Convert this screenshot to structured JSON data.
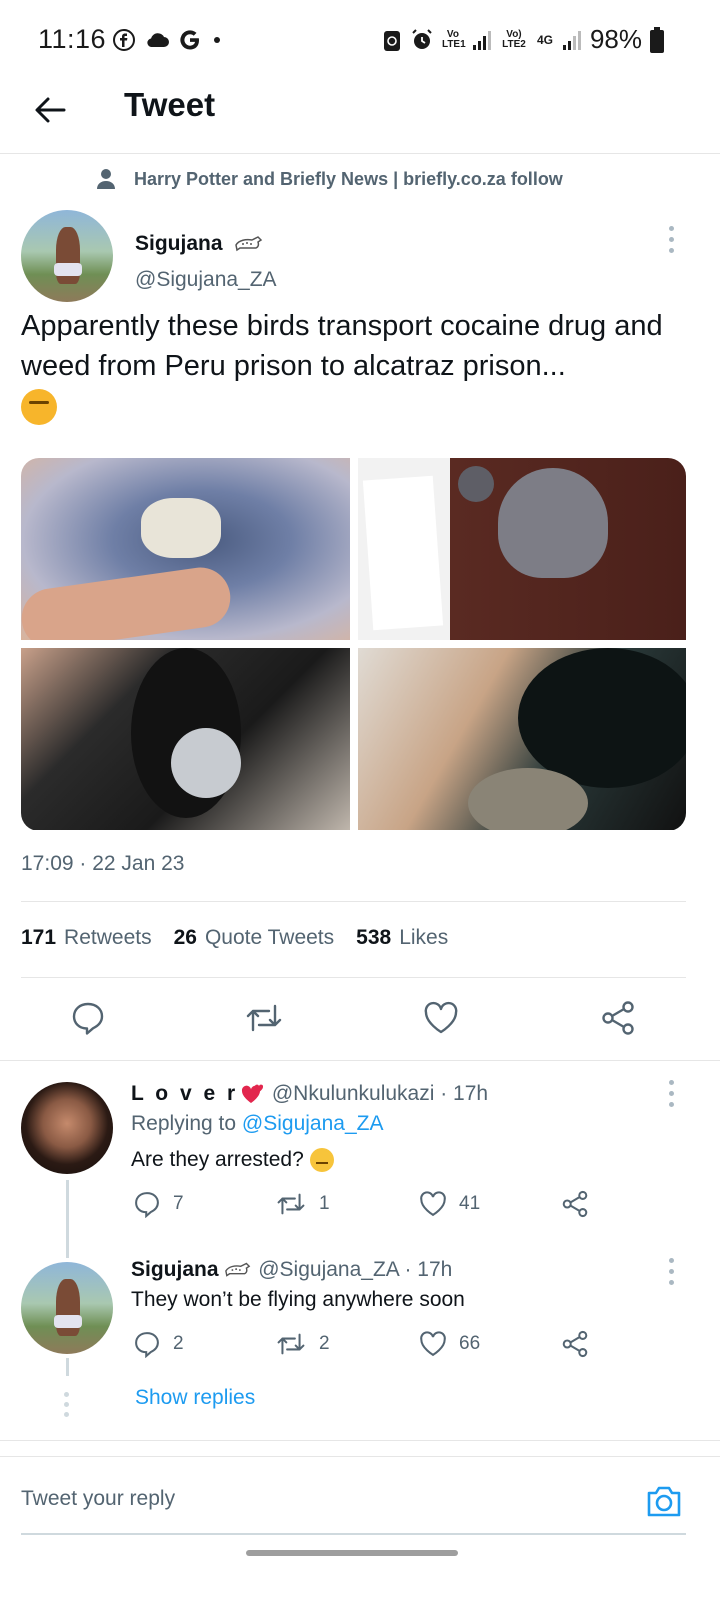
{
  "status_bar": {
    "time": "11:16",
    "battery": "98%",
    "lte1": "Vo LTE1",
    "lte2": "Vo) LTE2",
    "net": "4G"
  },
  "header": {
    "title": "Tweet"
  },
  "sponsor": "Harry Potter and Briefly News | briefly.co.za follow",
  "tweet": {
    "author_name": "Sigujana",
    "author_handle": "@Sigujana_ZA",
    "text": "Apparently these birds transport cocaine drug and weed from Peru prison to alcatraz prison...",
    "timestamp": "17:09 · 22 Jan 23",
    "retweets": "171",
    "retweets_label": "Retweets",
    "quotes": "26",
    "quotes_label": "Quote Tweets",
    "likes": "538",
    "likes_label": "Likes"
  },
  "replies": [
    {
      "name": "L o v e r",
      "handle_time": "@Nkulunkulukazi · 17h",
      "replying_prefix": "Replying to ",
      "replying_to": "@Sigujana_ZA",
      "text": "Are they arrested?",
      "comments": "7",
      "retweets": "1",
      "likes": "41"
    },
    {
      "name": "Sigujana",
      "handle_time": "@Sigujana_ZA · 17h",
      "text": "They won’t be flying anywhere soon",
      "comments": "2",
      "retweets": "2",
      "likes": "66"
    }
  ],
  "show_replies": "Show replies",
  "reply_bar": {
    "placeholder": "Tweet your reply"
  }
}
